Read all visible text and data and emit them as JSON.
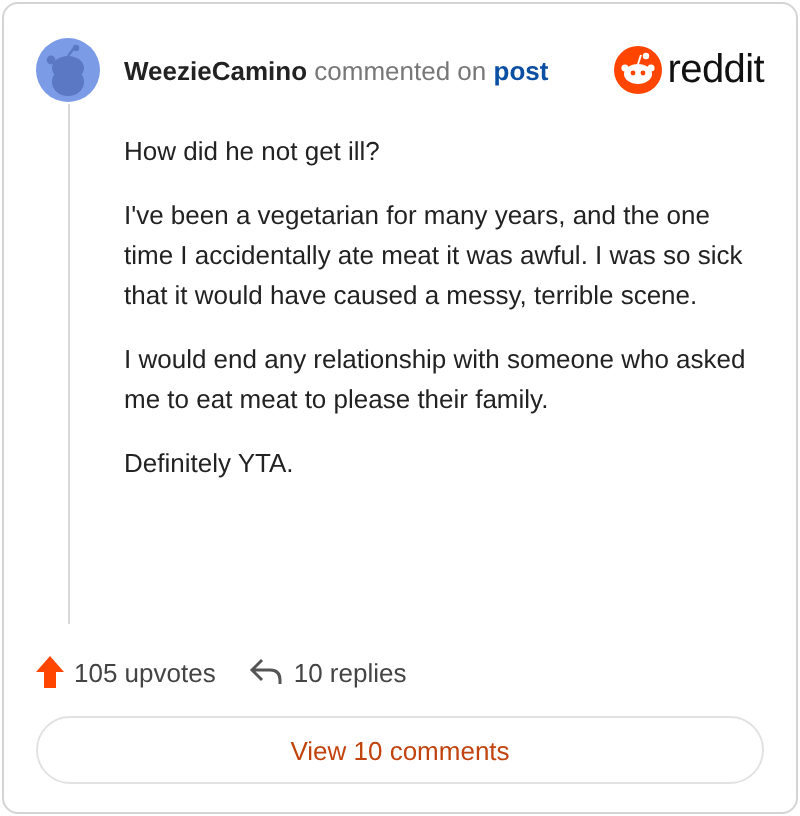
{
  "header": {
    "username": "WeezieCamino",
    "action": "commented on",
    "link": "post",
    "brand": "reddit"
  },
  "paragraphs": [
    "How did he not get ill?",
    "I've been a vegetarian for many years, and the one time I accidentally ate meat it was awful. I was so sick that it would have caused a messy, terrible scene.",
    "I would end any relationship with someone who asked me to eat meat to please their family.",
    "Definitely YTA."
  ],
  "footer": {
    "upvotes": "105 upvotes",
    "replies": "10 replies"
  },
  "button": "View 10 comments"
}
